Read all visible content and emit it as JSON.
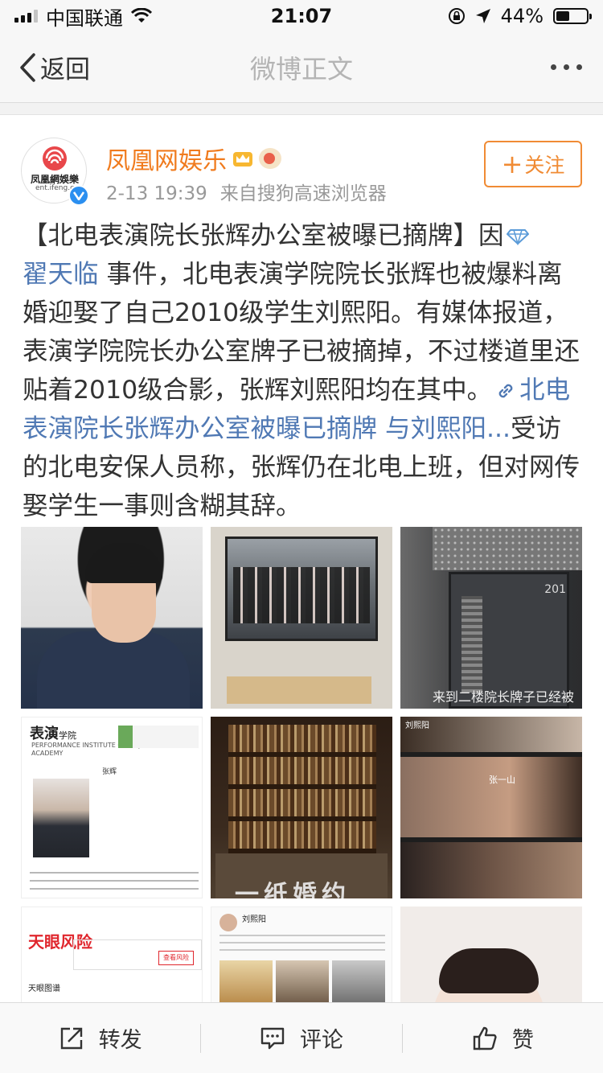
{
  "status_bar": {
    "carrier": "中国联通",
    "time": "21:07",
    "battery_percent": "44%",
    "battery_level": 0.44
  },
  "nav": {
    "back_label": "返回",
    "title": "微博正文"
  },
  "post": {
    "author": "凤凰网娱乐",
    "avatar_text": "凤凰網娛樂",
    "avatar_subtext": "ent.ifeng.c",
    "date": "2-13 19:39",
    "source": "来自搜狗高速浏览器",
    "follow_label": "关注",
    "text_part1": "【北电表演院长张辉办公室被曝已摘牌】因",
    "mention": "翟天临",
    "text_part2": " 事件，北电表演学院院长张辉也被爆料离婚迎娶了自己2010级学生刘熙阳。有媒体报道，表演学院院长办公室牌子已被摘掉，不过楼道里还贴着2010级合影，张辉刘熙阳均在其中。",
    "link_text": "北电表演院长张辉办公室被曝已摘牌 与刘熙阳...",
    "text_part3": "受访的北电安保人员称，张辉仍在北电上班，但对网传娶学生一事则含糊其辞。"
  },
  "images": {
    "door_number": "201",
    "door_caption": "来到二楼院长牌子已经被",
    "page_brand": "表演",
    "page_brand_small": "学院",
    "page_sub": "PERFORMANCE INSTITUTE OF BEIJING FILM ACADEMY",
    "page_name": "张辉",
    "movie_title": "一纸婚约",
    "scene_name": "刘熙阳",
    "scene_name2": "张一山",
    "risk_logo": "天眼风险",
    "risk_button": "查看风险",
    "risk_heading": "天眼图谱",
    "weibo_name": "刘熙阳"
  },
  "toolbar": {
    "repost": "转发",
    "comment": "评论",
    "like": "赞"
  },
  "colors": {
    "accent": "#f07b1e",
    "link": "#5079b4",
    "verified": "#2b8ff0"
  }
}
